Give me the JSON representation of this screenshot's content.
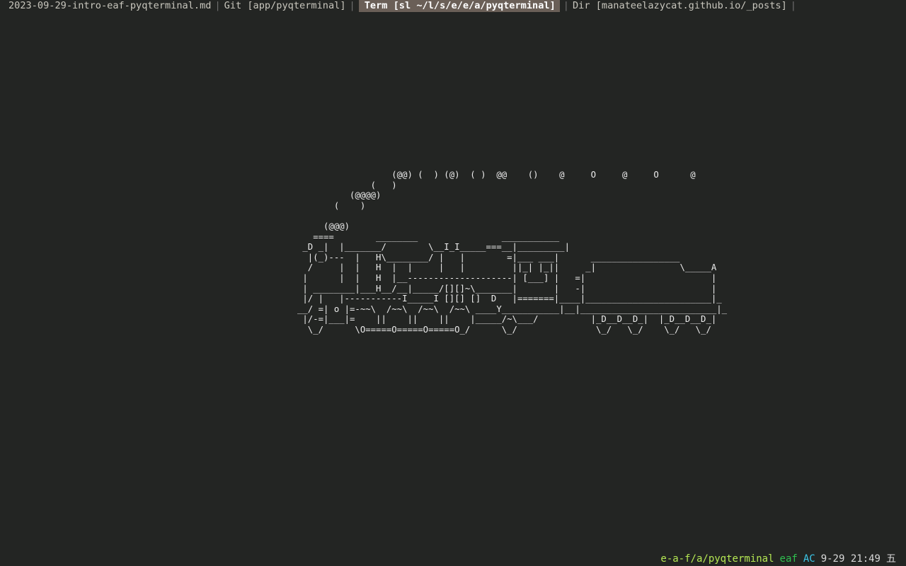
{
  "tabs": [
    {
      "label": "2023-09-29-intro-eaf-pyqterminal.md",
      "active": false
    },
    {
      "label": "Git [app/pyqterminal]",
      "active": false
    },
    {
      "label": "Term [sl ~/l/s/e/e/a/pyqterminal]",
      "active": true
    },
    {
      "label": "Dir [manateelazycat.github.io/_posts]",
      "active": false
    }
  ],
  "separator": "|",
  "terminal": {
    "train_ascii": "                  (@@) (  ) (@)  ( )  @@    ()    @     O     @     O      @\n              (   )\n          (@@@@)\n       (    )\n\n     (@@@)\n   ====        ________                ___________\n _D _|  |_______/        \\__I_I_____===__|_________|\n  |(_)---  |   H\\________/ |   |        =|___ ___|      _________________\n  /     |  |   H  |  |     |   |         ||_| |_||     _|                \\_____A\n |      |  |   H  |__--------------------| [___] |   =|                        |\n | ________|___H__/__|_____/[][]~\\_______|       |   -|                        |\n |/ |   |-----------I_____I [][] []  D   |=======|____|________________________|_\n__/ =| o |=-~~\\  /~~\\  /~~\\  /~~\\ ____Y___________|__|__________________________|_\n |/-=|___|=    ||    ||    ||    |_____/~\\___/          |_D__D__D_|  |_D__D__D_|\n  \\_/      \\O=====O=====O=====O_/      \\_/               \\_/   \\_/    \\_/   \\_/"
  },
  "modeline": {
    "path": "e-a-f/a/pyqterminal",
    "mode": "eaf",
    "ac": "AC",
    "datetime": "9-29 21:49",
    "weekday": "五"
  },
  "colors": {
    "background": "#232523",
    "active_tab_bg": "#6a5f57",
    "path": "#b5e853",
    "mode": "#2fbf4f",
    "ac": "#3cc7e8"
  }
}
